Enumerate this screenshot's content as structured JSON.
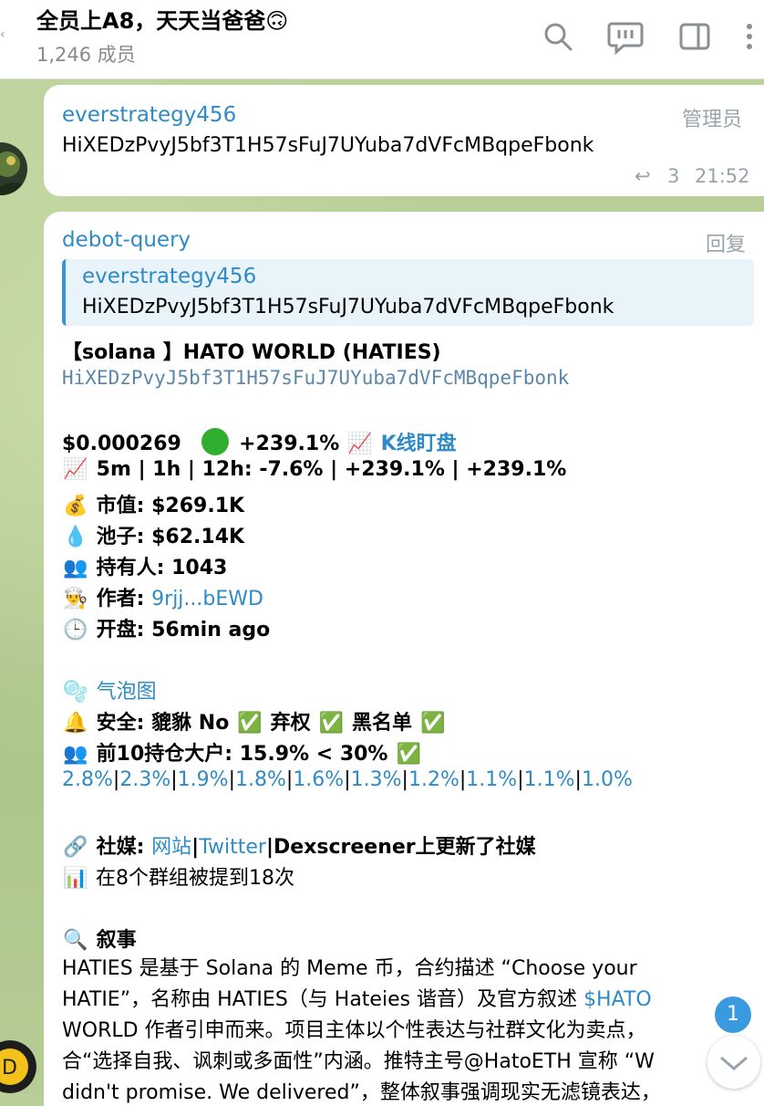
{
  "header": {
    "title": "全员上A8，天天当爸爸🙃",
    "subtitle": "1,246 成员",
    "icons": [
      "search-icon",
      "comment-icon",
      "sidebar-icon",
      "more-icon"
    ]
  },
  "message1": {
    "sender": "everstrategy456",
    "role": "管理员",
    "text": "HiXEDzPvyJ5bf3T1H57sFuJ7UYuba7dVFcMBqpeFbonk",
    "reply_count": "3",
    "time": "21:52"
  },
  "message2": {
    "sender": "debot-query",
    "action": "回复",
    "quote_sender": "everstrategy456",
    "quote_text": "HiXEDzPvyJ5bf3T1H57sFuJ7UYuba7dVFcMBqpeFbonk",
    "token_line": "【solana 】HATO WORLD (HATIES)",
    "address": "HiXEDzPvyJ5bf3T1H57sFuJ7UYuba7dVFcMBqpeFbonk",
    "price": "$0.000269",
    "change": "+239.1%",
    "kline_link": "K线盯盘",
    "periods": "5m | 1h | 12h: -7.6%  | +239.1%  | +239.1%",
    "market_cap": "市值: $269.1K",
    "pool": "池子: $62.14K",
    "holders": "持有人: 1043",
    "author_label": "作者:",
    "author_link": "9rjj...bEWD",
    "open": "开盘: 56min ago",
    "bubble_link": "气泡图",
    "security_a": "安全: 貔貅 No",
    "security_b": "弃权",
    "security_c": "黑名单",
    "top10": "前10持仓大户: 15.9% < 30%",
    "holdings": [
      "2.8%",
      "2.3%",
      "1.9%",
      "1.8%",
      "1.6%",
      "1.3%",
      "1.2%",
      "1.1%",
      "1.1%",
      "1.0%"
    ],
    "social_label": "社媒:",
    "social_site": "网站",
    "social_twitter": "Twitter",
    "social_rest": "|Dexscreener上更新了社媒",
    "mentions": "在8个群组被提到18次",
    "narrative_title": "叙事",
    "narrative_1": "HATIES 是基于 Solana 的 Meme 币，合约描述 “Choose your",
    "narrative_2": "HATIE”，名称由 HATIES（与 Hateies 谐音）及官方叙述 ",
    "narrative_2_link": "$HATO",
    "narrative_3": "WORLD 作者引申而来。项目主体以个性表达与社群文化为卖点，",
    "narrative_4": "合“选择自我、讽刺或多面性”内涵。推特主号@HatoETH 宣称 “W",
    "narrative_5": "didn't promise. We delivered”，整体叙事强调现实无滤镜表达，"
  },
  "badge": "1"
}
